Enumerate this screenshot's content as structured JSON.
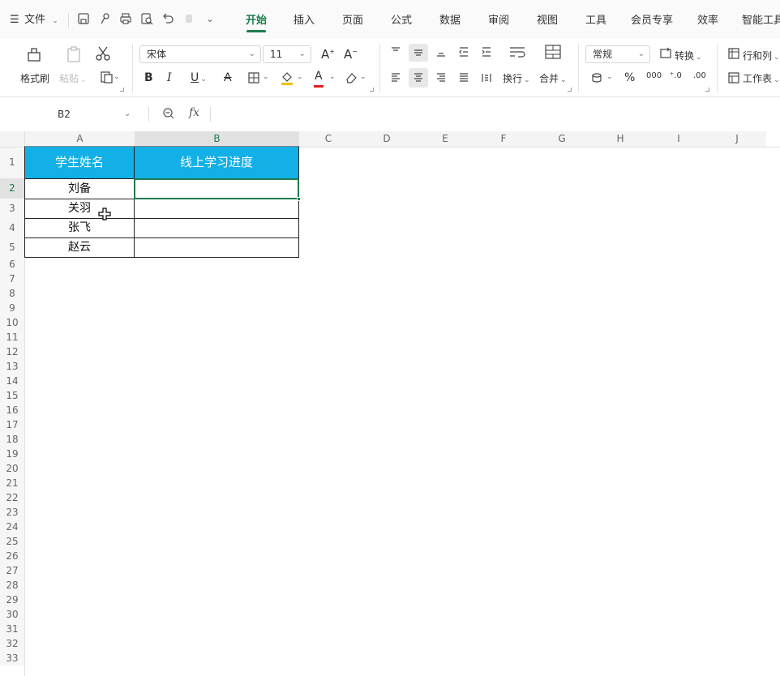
{
  "menubar": {
    "file_label": "文件",
    "tabs": [
      "开始",
      "插入",
      "页面",
      "公式",
      "数据",
      "审阅",
      "视图",
      "工具",
      "会员专享",
      "效率",
      "智能工具"
    ],
    "active_tab": "开始"
  },
  "ribbon": {
    "format_painter": "格式刷",
    "paste": "粘贴",
    "font_name": "宋体",
    "font_size": "11",
    "wrap_text": "换行",
    "merge": "合并",
    "number_format": "常规",
    "convert": "转换",
    "rows_cols": "行和列",
    "worksheet": "工作表",
    "percent": "%",
    "thousands": "000",
    "bold": "B",
    "italic": "I",
    "underline": "U",
    "font_grow": "A",
    "font_shrink": "A",
    "font_color_letter": "A",
    "accent_color": "#1e7d4f",
    "fill_underline_color": "#f2c200",
    "font_underline_color": "#e02020"
  },
  "formula_bar": {
    "cell_ref": "B2",
    "fx": "fx",
    "content": ""
  },
  "sheet": {
    "columns": [
      "A",
      "B",
      "C",
      "D",
      "E",
      "F",
      "G",
      "H",
      "I",
      "J"
    ],
    "rows": [
      "1",
      "2",
      "3",
      "4",
      "5",
      "6",
      "7",
      "8",
      "9",
      "10",
      "11",
      "12",
      "13",
      "14",
      "15",
      "16",
      "17",
      "18",
      "19",
      "20",
      "21",
      "22",
      "23",
      "24",
      "25",
      "26",
      "27",
      "28",
      "29",
      "30",
      "31",
      "32",
      "33"
    ],
    "selected_cell": "B2",
    "header_fill": "#12b0e6",
    "table": {
      "headers": [
        "学生姓名",
        "线上学习进度"
      ],
      "names": [
        "刘备",
        "关羽",
        "张飞",
        "赵云"
      ],
      "progress": [
        "",
        "",
        "",
        ""
      ]
    }
  }
}
